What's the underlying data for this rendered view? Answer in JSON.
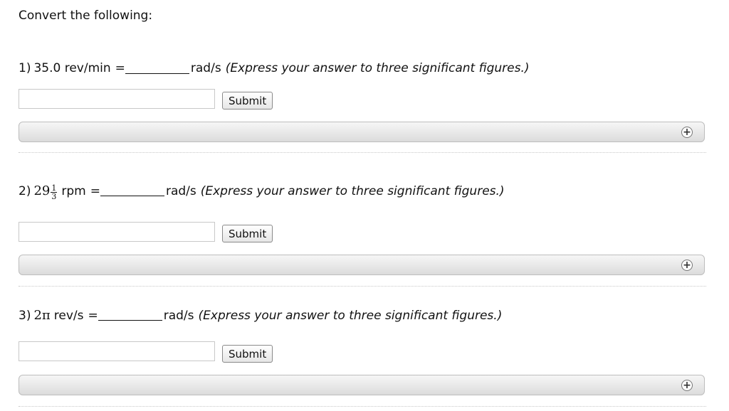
{
  "intro": "Convert the following:",
  "questions": [
    {
      "number": "1)",
      "quantity": "35.0 rev/min",
      "equals": "=",
      "unit": "rad/s",
      "hint": "(Express your answer to three significant figures.)",
      "input_value": "",
      "submit_label": "Submit",
      "expand_icon": "+"
    },
    {
      "number": "2)",
      "whole": "29",
      "frac_num": "1",
      "frac_den": "3",
      "quantity_unit": "rpm",
      "equals": "=",
      "unit": "rad/s",
      "hint": "(Express your answer to three significant figures.)",
      "input_value": "",
      "submit_label": "Submit",
      "expand_icon": "+"
    },
    {
      "number": "3)",
      "quantity_math": "2π",
      "quantity_unit": "rev/s",
      "equals": "=",
      "unit": "rad/s",
      "hint": "(Express your answer to three significant figures.)",
      "input_value": "",
      "submit_label": "Submit",
      "expand_icon": "+"
    }
  ]
}
